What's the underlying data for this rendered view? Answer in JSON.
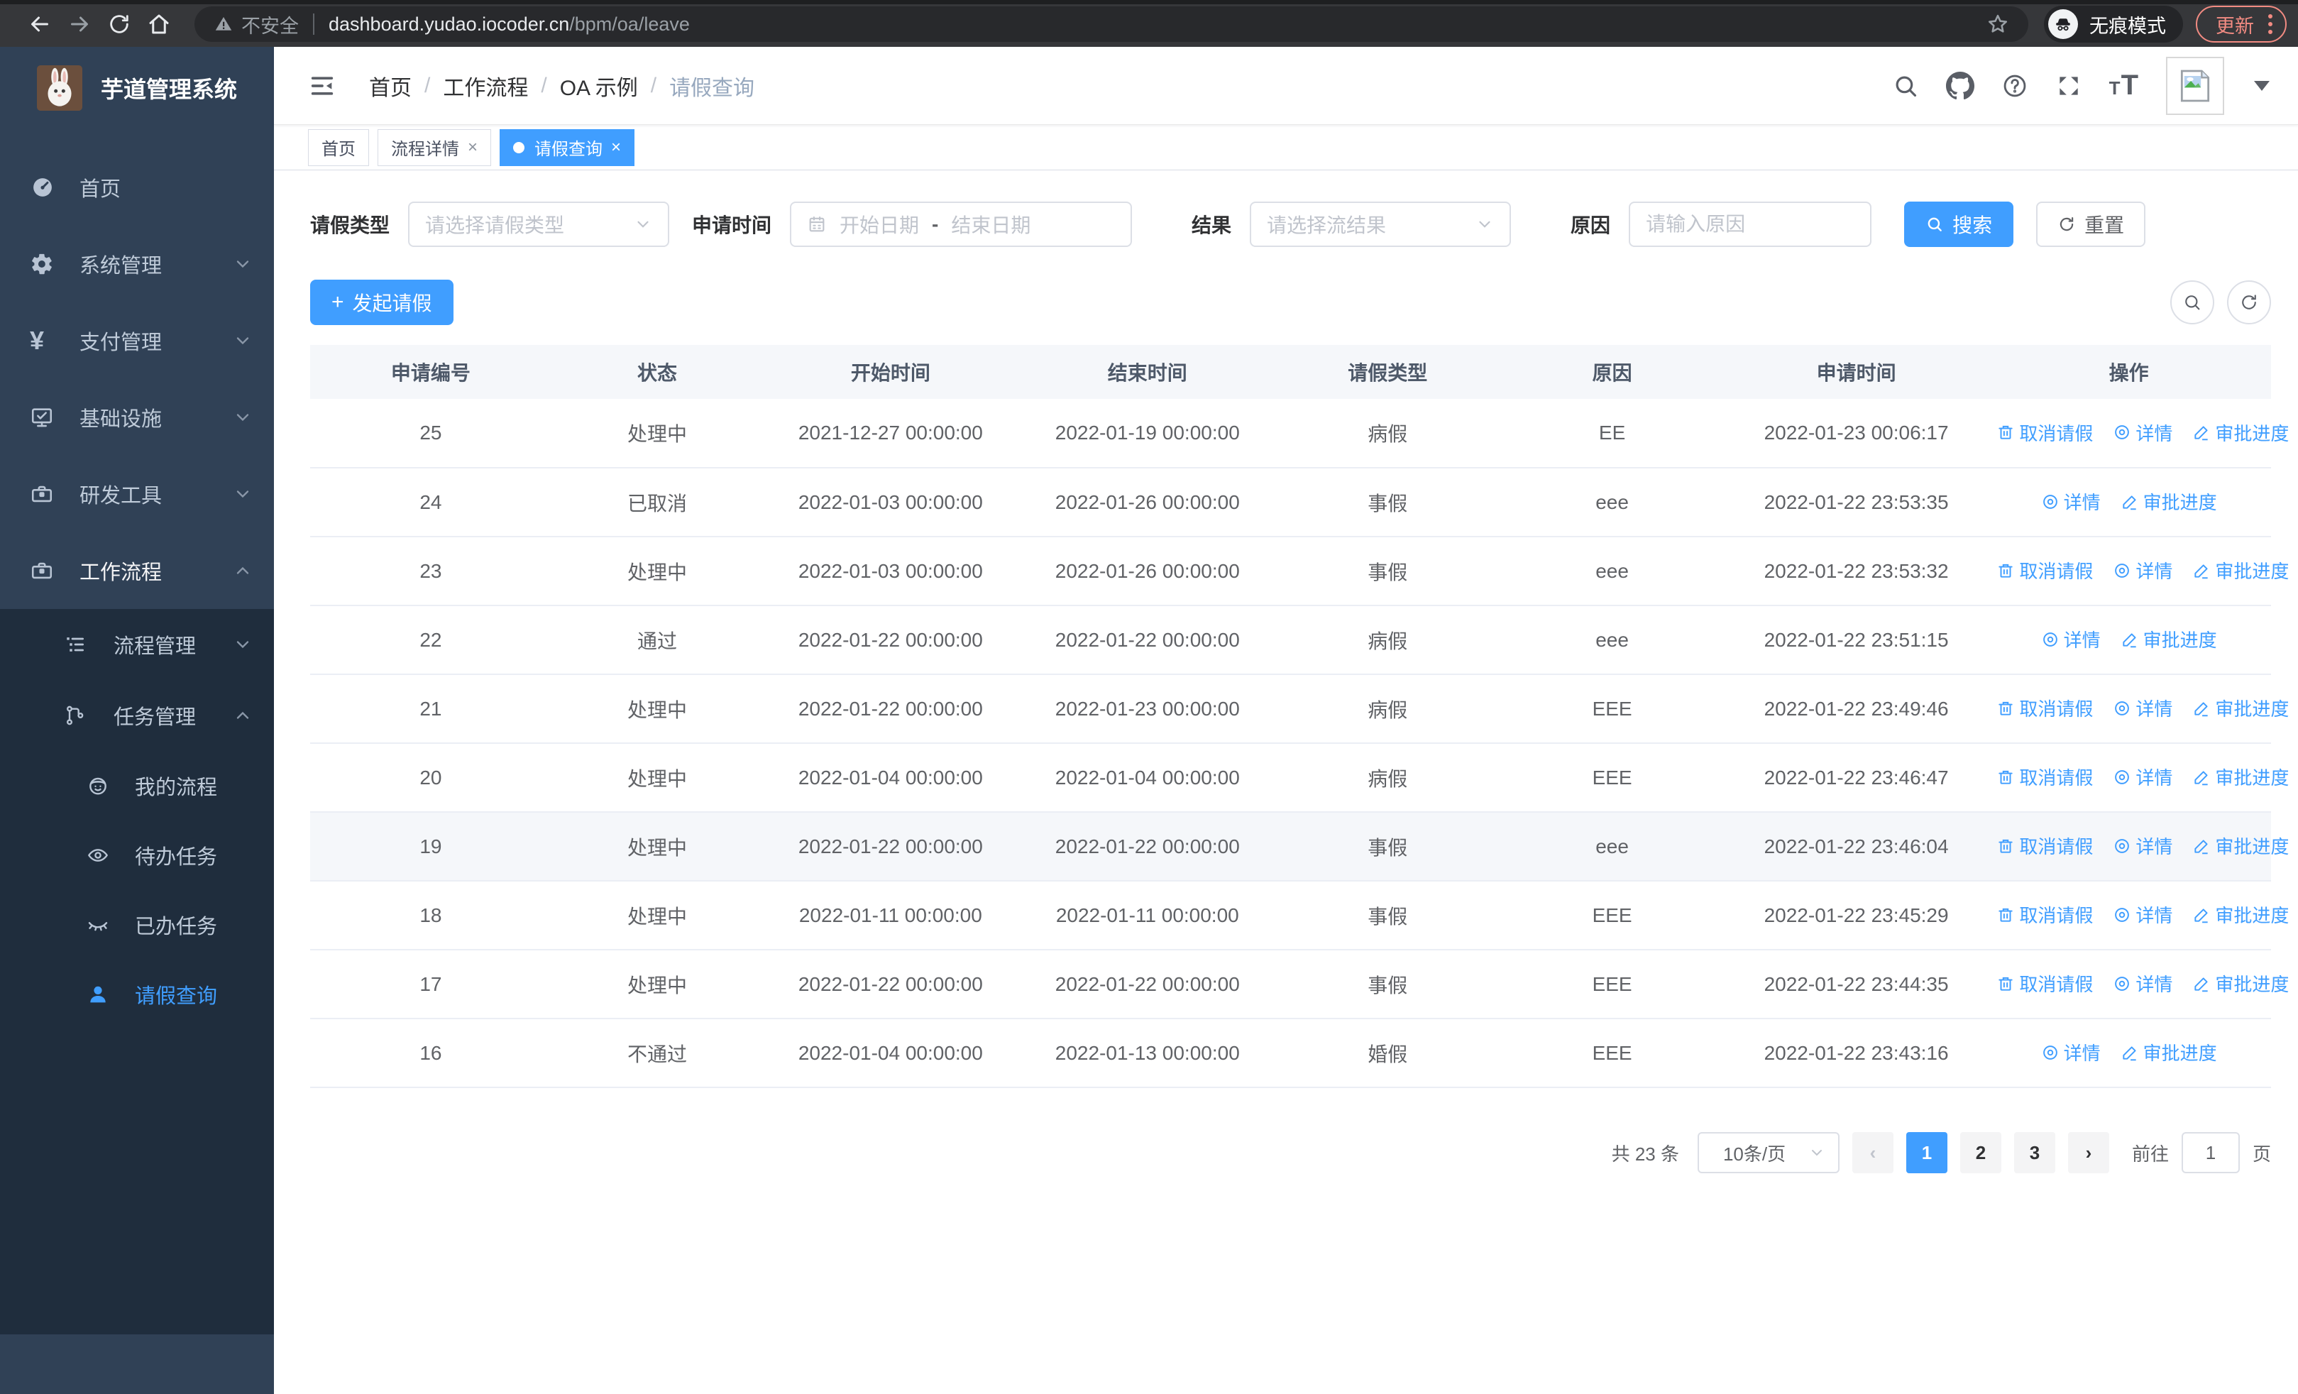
{
  "browser": {
    "security_label": "不安全",
    "url_host": "dashboard.yudao.iocoder.cn",
    "url_path": "/bpm/oa/leave",
    "incognito_label": "无痕模式",
    "update_label": "更新"
  },
  "sidebar": {
    "title": "芋道管理系统",
    "items": [
      {
        "label": "首页",
        "icon": "dashboard-icon"
      },
      {
        "label": "系统管理",
        "icon": "gear-icon"
      },
      {
        "label": "支付管理",
        "icon": "yen-icon"
      },
      {
        "label": "基础设施",
        "icon": "monitor-icon"
      },
      {
        "label": "研发工具",
        "icon": "briefcase-icon"
      },
      {
        "label": "工作流程",
        "icon": "briefcase-icon",
        "expanded": true
      }
    ],
    "submenu": [
      {
        "label": "流程管理",
        "icon": "tree-list-icon"
      },
      {
        "label": "任务管理",
        "icon": "flow-icon",
        "expanded": true,
        "children": [
          {
            "label": "我的流程",
            "icon": "face-icon"
          },
          {
            "label": "待办任务",
            "icon": "eye-icon"
          },
          {
            "label": "已办任务",
            "icon": "eye-closed-icon"
          },
          {
            "label": "请假查询",
            "icon": "user-icon",
            "active": true
          }
        ]
      }
    ]
  },
  "header": {
    "breadcrumb": [
      "首页",
      "工作流程",
      "OA 示例",
      "请假查询"
    ]
  },
  "tabs": [
    {
      "label": "首页",
      "closable": false,
      "active": false
    },
    {
      "label": "流程详情",
      "closable": true,
      "active": false
    },
    {
      "label": "请假查询",
      "closable": true,
      "active": true
    }
  ],
  "filters": {
    "leave_type_label": "请假类型",
    "leave_type_placeholder": "请选择请假类型",
    "apply_time_label": "申请时间",
    "start_date_placeholder": "开始日期",
    "range_separator": "-",
    "end_date_placeholder": "结束日期",
    "result_label": "结果",
    "result_placeholder": "请选择流结果",
    "reason_label": "原因",
    "reason_placeholder": "请输入原因",
    "search_label": "搜索",
    "reset_label": "重置"
  },
  "toolbar": {
    "create_label": "发起请假"
  },
  "table": {
    "columns": [
      "申请编号",
      "状态",
      "开始时间",
      "结束时间",
      "请假类型",
      "原因",
      "申请时间",
      "操作"
    ],
    "action_labels": {
      "cancel": "取消请假",
      "detail": "详情",
      "progress": "审批进度"
    },
    "rows": [
      {
        "id": "25",
        "status": "处理中",
        "start": "2021-12-27 00:00:00",
        "end": "2022-01-19 00:00:00",
        "type": "病假",
        "reason": "EE",
        "applyTime": "2022-01-23 00:06:17",
        "actions": [
          "cancel",
          "detail",
          "progress"
        ],
        "hover": false
      },
      {
        "id": "24",
        "status": "已取消",
        "start": "2022-01-03 00:00:00",
        "end": "2022-01-26 00:00:00",
        "type": "事假",
        "reason": "eee",
        "applyTime": "2022-01-22 23:53:35",
        "actions": [
          "detail",
          "progress"
        ],
        "hover": false
      },
      {
        "id": "23",
        "status": "处理中",
        "start": "2022-01-03 00:00:00",
        "end": "2022-01-26 00:00:00",
        "type": "事假",
        "reason": "eee",
        "applyTime": "2022-01-22 23:53:32",
        "actions": [
          "cancel",
          "detail",
          "progress"
        ],
        "hover": false
      },
      {
        "id": "22",
        "status": "通过",
        "start": "2022-01-22 00:00:00",
        "end": "2022-01-22 00:00:00",
        "type": "病假",
        "reason": "eee",
        "applyTime": "2022-01-22 23:51:15",
        "actions": [
          "detail",
          "progress"
        ],
        "hover": false
      },
      {
        "id": "21",
        "status": "处理中",
        "start": "2022-01-22 00:00:00",
        "end": "2022-01-23 00:00:00",
        "type": "病假",
        "reason": "EEE",
        "applyTime": "2022-01-22 23:49:46",
        "actions": [
          "cancel",
          "detail",
          "progress"
        ],
        "hover": false
      },
      {
        "id": "20",
        "status": "处理中",
        "start": "2022-01-04 00:00:00",
        "end": "2022-01-04 00:00:00",
        "type": "病假",
        "reason": "EEE",
        "applyTime": "2022-01-22 23:46:47",
        "actions": [
          "cancel",
          "detail",
          "progress"
        ],
        "hover": false
      },
      {
        "id": "19",
        "status": "处理中",
        "start": "2022-01-22 00:00:00",
        "end": "2022-01-22 00:00:00",
        "type": "事假",
        "reason": "eee",
        "applyTime": "2022-01-22 23:46:04",
        "actions": [
          "cancel",
          "detail",
          "progress"
        ],
        "hover": true
      },
      {
        "id": "18",
        "status": "处理中",
        "start": "2022-01-11 00:00:00",
        "end": "2022-01-11 00:00:00",
        "type": "事假",
        "reason": "EEE",
        "applyTime": "2022-01-22 23:45:29",
        "actions": [
          "cancel",
          "detail",
          "progress"
        ],
        "hover": false
      },
      {
        "id": "17",
        "status": "处理中",
        "start": "2022-01-22 00:00:00",
        "end": "2022-01-22 00:00:00",
        "type": "事假",
        "reason": "EEE",
        "applyTime": "2022-01-22 23:44:35",
        "actions": [
          "cancel",
          "detail",
          "progress"
        ],
        "hover": false
      },
      {
        "id": "16",
        "status": "不通过",
        "start": "2022-01-04 00:00:00",
        "end": "2022-01-13 00:00:00",
        "type": "婚假",
        "reason": "EEE",
        "applyTime": "2022-01-22 23:43:16",
        "actions": [
          "detail",
          "progress"
        ],
        "hover": false
      }
    ]
  },
  "pagination": {
    "total_label": "共 23 条",
    "page_size": "10条/页",
    "pages": [
      "1",
      "2",
      "3"
    ],
    "active_page": "1",
    "goto_label": "前往",
    "goto_value": "1",
    "page_unit_label": "页"
  },
  "colors": {
    "accent": "#409eff",
    "sidebar_bg": "#304156",
    "submenu_bg": "#1f2d3d",
    "update_accent": "#f28b82",
    "hover_row": "#f5f7fa"
  },
  "icons": {
    "chrome": [
      "back-icon",
      "forward-icon",
      "reload-icon",
      "home-icon",
      "warning-icon",
      "star-icon",
      "incognito-icon",
      "more-vert-icon"
    ],
    "topbar": [
      "hamburger-icon",
      "search-icon",
      "github-icon",
      "help-icon",
      "fullscreen-icon",
      "font-size-icon",
      "avatar-placeholder-icon",
      "caret-down-icon"
    ],
    "actions": [
      "trash-icon",
      "view-icon",
      "edit-icon"
    ]
  }
}
